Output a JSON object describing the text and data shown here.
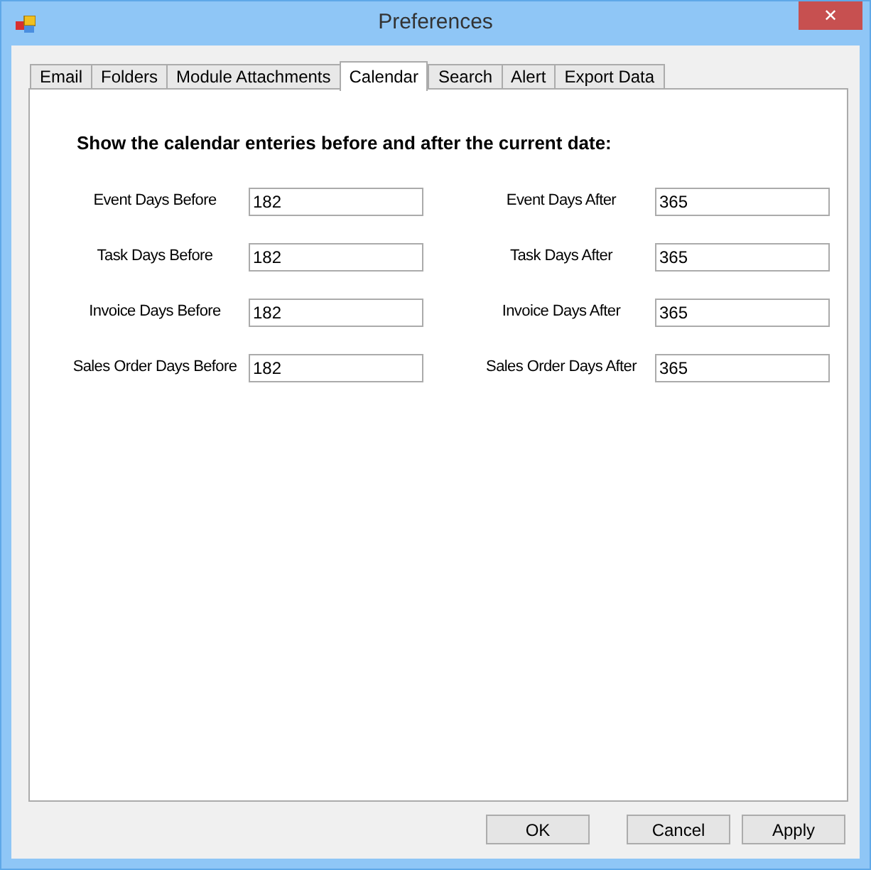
{
  "window": {
    "title": "Preferences",
    "close": "✕"
  },
  "tabs": [
    {
      "label": "Email",
      "selected": false
    },
    {
      "label": "Folders",
      "selected": false
    },
    {
      "label": "Module Attachments",
      "selected": false
    },
    {
      "label": "Calendar",
      "selected": true
    },
    {
      "label": "Search",
      "selected": false
    },
    {
      "label": "Alert",
      "selected": false
    },
    {
      "label": "Export Data",
      "selected": false
    }
  ],
  "heading": "Show the calendar enteries before and after the current date:",
  "rows": [
    {
      "before_label": "Event Days Before",
      "before_value": "182",
      "after_label": "Event Days After",
      "after_value": "365"
    },
    {
      "before_label": "Task Days Before",
      "before_value": "182",
      "after_label": "Task Days After",
      "after_value": "365"
    },
    {
      "before_label": "Invoice Days Before",
      "before_value": "182",
      "after_label": "Invoice Days After",
      "after_value": "365"
    },
    {
      "before_label": "Sales Order Days Before",
      "before_value": "182",
      "after_label": "Sales Order Days After",
      "after_value": "365"
    }
  ],
  "buttons": [
    "OK",
    "Cancel",
    "Apply"
  ]
}
